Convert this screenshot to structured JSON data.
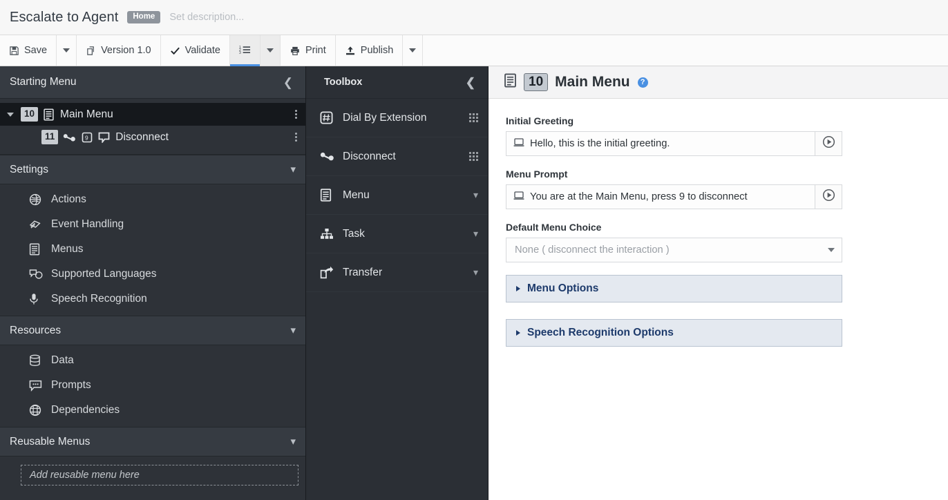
{
  "titlebar": {
    "app_title": "Escalate to Agent",
    "home_badge": "Home",
    "description_placeholder": "Set description..."
  },
  "toolbar": {
    "save_label": "Save",
    "version_label": "Version 1.0",
    "validate_label": "Validate",
    "print_label": "Print",
    "publish_label": "Publish"
  },
  "sidebar": {
    "header_title": "Starting Menu",
    "tree": [
      {
        "badge": "10",
        "label": "Main Menu",
        "selected": true,
        "icon": "menu-list-icon"
      },
      {
        "badge": "11",
        "label": "Disconnect",
        "selected": false,
        "icon": "disconnect-icon",
        "key_badge": "9",
        "bubble": "speech-bubble-icon"
      }
    ],
    "sections": [
      {
        "title": "Settings",
        "items": [
          {
            "label": "Actions",
            "icon": "globe-icon"
          },
          {
            "label": "Event Handling",
            "icon": "diamond-stack-icon"
          },
          {
            "label": "Menus",
            "icon": "menu-list-icon"
          },
          {
            "label": "Supported Languages",
            "icon": "speech-bubbles-icon"
          },
          {
            "label": "Speech Recognition",
            "icon": "microphone-icon"
          }
        ]
      },
      {
        "title": "Resources",
        "items": [
          {
            "label": "Data",
            "icon": "database-icon"
          },
          {
            "label": "Prompts",
            "icon": "chat-bubble-icon"
          },
          {
            "label": "Dependencies",
            "icon": "dependency-sphere-icon"
          }
        ]
      }
    ],
    "reusable": {
      "title": "Reusable Menus",
      "dropzone_text": "Add reusable menu here"
    }
  },
  "toolbox": {
    "header_title": "Toolbox",
    "items": [
      {
        "label": "Dial By Extension",
        "icon": "hash-box-icon",
        "trailing": "grip"
      },
      {
        "label": "Disconnect",
        "icon": "disconnect-icon",
        "trailing": "grip"
      },
      {
        "label": "Menu",
        "icon": "menu-list-icon",
        "trailing": "chevron"
      },
      {
        "label": "Task",
        "icon": "task-tree-icon",
        "trailing": "chevron"
      },
      {
        "label": "Transfer",
        "icon": "transfer-arrow-icon",
        "trailing": "chevron"
      }
    ]
  },
  "main": {
    "header": {
      "badge": "10",
      "title": "Main Menu",
      "help": "?"
    },
    "fields": [
      {
        "label": "Initial Greeting",
        "value": "Hello, this is the initial greeting.",
        "kind": "prompt"
      },
      {
        "label": "Menu Prompt",
        "value": "You are at the Main Menu, press 9 to disconnect",
        "kind": "prompt"
      }
    ],
    "default_choice": {
      "label": "Default Menu Choice",
      "value": "None ( disconnect the interaction )"
    },
    "accordions": [
      {
        "label": "Menu Options"
      },
      {
        "label": "Speech Recognition Options"
      }
    ]
  },
  "colors": {
    "sidebar_bg": "#2e3238",
    "sidebar_header_bg": "#363b42",
    "toolbox_bg": "#2b2f35",
    "accent_blue": "#4a90e2",
    "accordion_bg": "#e4e9f0",
    "accordion_text": "#1d3a6b"
  }
}
